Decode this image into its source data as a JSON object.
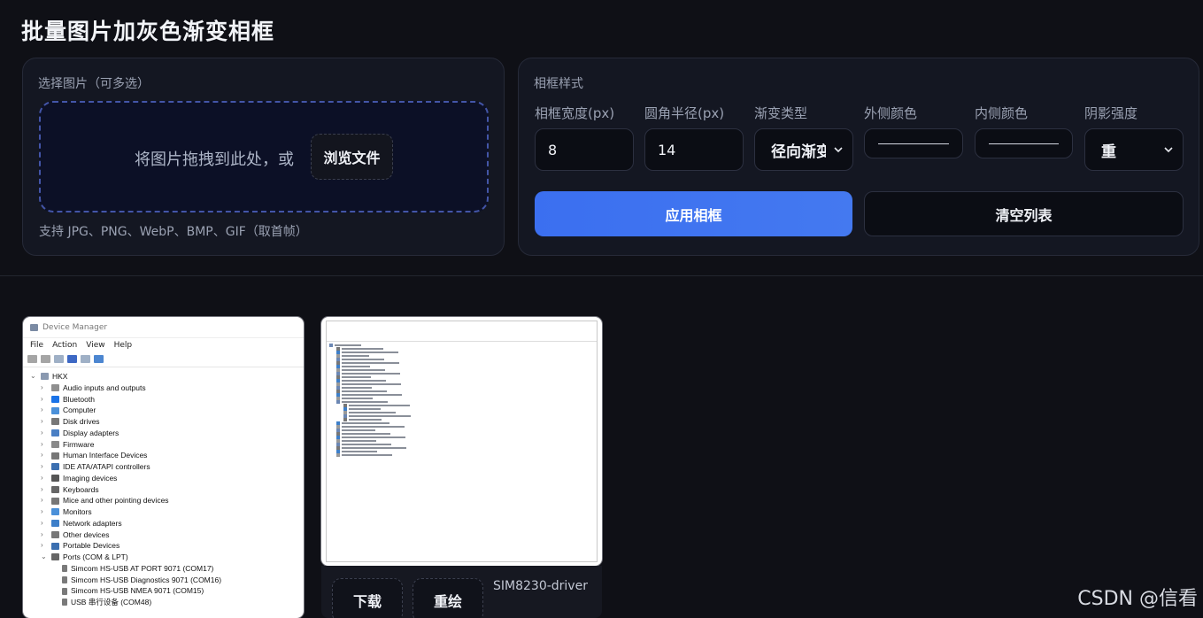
{
  "app": {
    "title": "批量图片加灰色渐变相框"
  },
  "upload": {
    "label": "选择图片（可多选）",
    "drop_text": "将图片拖拽到此处，或",
    "browse_label": "浏览文件",
    "support_text": "支持 JPG、PNG、WebP、BMP、GIF（取首帧）"
  },
  "frame": {
    "section_label": "相框样式",
    "fields": {
      "width_label": "相框宽度(px)",
      "width_value": "8",
      "radius_label": "圆角半径(px)",
      "radius_value": "14",
      "gradient_label": "渐变类型",
      "gradient_value": "径向渐变",
      "outer_color_label": "外侧颜色",
      "inner_color_label": "内侧颜色",
      "shadow_label": "阴影强度",
      "shadow_value": "重"
    },
    "apply_label": "应用相框",
    "clear_label": "清空列表"
  },
  "thumbnails": [
    {
      "window_title": "Device Manager",
      "menu": [
        "File",
        "Action",
        "View",
        "Help"
      ],
      "root": "HKX",
      "items": [
        "Audio inputs and outputs",
        "Bluetooth",
        "Computer",
        "Disk drives",
        "Display adapters",
        "Firmware",
        "Human Interface Devices",
        "IDE ATA/ATAPI controllers",
        "Imaging devices",
        "Keyboards",
        "Mice and other pointing devices",
        "Monitors",
        "Network adapters",
        "Other devices",
        "Portable Devices",
        "Ports (COM & LPT)"
      ],
      "port_items": [
        "Simcom HS-USB AT PORT 9071 (COM17)",
        "Simcom HS-USB Diagnostics 9071 (COM16)",
        "Simcom HS-USB NMEA 9071 (COM15)",
        "USB 串行设备 (COM48)"
      ]
    },
    {
      "file_name": "SIM8230-driver",
      "download_label": "下载",
      "redraw_label": "重绘"
    }
  ],
  "watermark": "CSDN @信看",
  "colors": {
    "accent": "#3b6ff0",
    "background": "#0f1016",
    "panel": "#141722"
  }
}
